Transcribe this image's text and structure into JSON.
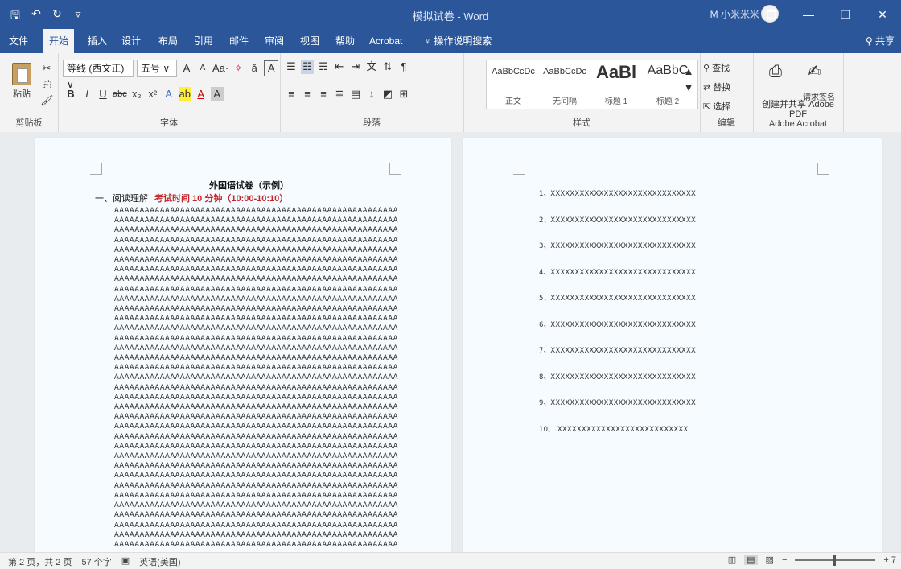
{
  "window": {
    "title": "模拟试卷 - Word",
    "user": "M 小米米米",
    "controls": [
      "🗖",
      "—",
      "❐",
      "✕"
    ]
  },
  "quick_access": [
    "🖫",
    "↶",
    "↻",
    "▿"
  ],
  "tabs": [
    "文件",
    "开始",
    "插入",
    "设计",
    "布局",
    "引用",
    "邮件",
    "审阅",
    "视图",
    "帮助",
    "Acrobat",
    "操作说明搜索"
  ],
  "active_tab": "开始",
  "share": "共享",
  "ribbon": {
    "clipboard": {
      "paste": "粘贴",
      "label": "剪贴板"
    },
    "font": {
      "name": "等线 (西文正)",
      "size": "五号",
      "label": "字体",
      "aa": "Aa·",
      "grow": "A",
      "shrink": "A"
    },
    "paragraph": {
      "label": "段落"
    },
    "styles": {
      "label": "样式",
      "items": [
        {
          "sample": "AaBbCcDc",
          "name": "正文"
        },
        {
          "sample": "AaBbCcDc",
          "name": "无间隔"
        },
        {
          "sample": "AaBl",
          "name": "标题 1"
        },
        {
          "sample": "AaBbC",
          "name": "标题 2"
        }
      ]
    },
    "editing": {
      "find": "查找",
      "replace": "替换",
      "select": "选择",
      "label": "编辑"
    },
    "acrobat": {
      "create_pdf": "创建并共享 Adobe PDF",
      "sign": "请求签名",
      "label": "Adobe Acrobat"
    }
  },
  "document": {
    "title": "外国语试卷（示例）",
    "section": "一、阅读理解",
    "exam_time": "考试时间 10 分钟（10:00-10:10）",
    "line_text": "AAAAAAAAAAAAAAAAAAAAAAAAAAAAAAAAAAAAAAAAAAAAAAAAAAAAAAAA",
    "line_count": 35,
    "items": [
      "1、XXXXXXXXXXXXXXXXXXXXXXXXXXXXXX",
      "2、XXXXXXXXXXXXXXXXXXXXXXXXXXXXXX",
      "3、XXXXXXXXXXXXXXXXXXXXXXXXXXXXXX",
      "4、XXXXXXXXXXXXXXXXXXXXXXXXXXXXXX",
      "5、XXXXXXXXXXXXXXXXXXXXXXXXXXXXXX",
      "6、XXXXXXXXXXXXXXXXXXXXXXXXXXXXXX",
      "7、XXXXXXXXXXXXXXXXXXXXXXXXXXXXXX",
      "8、XXXXXXXXXXXXXXXXXXXXXXXXXXXXXX",
      "9、XXXXXXXXXXXXXXXXXXXXXXXXXXXXXX",
      "10、     XXXXXXXXXXXXXXXXXXXXXXXXXXX"
    ]
  },
  "statusbar": {
    "page": "第 2 页，共 2 页",
    "words": "57 个字",
    "language": "英语(美国)",
    "zoom": "+ 7"
  }
}
